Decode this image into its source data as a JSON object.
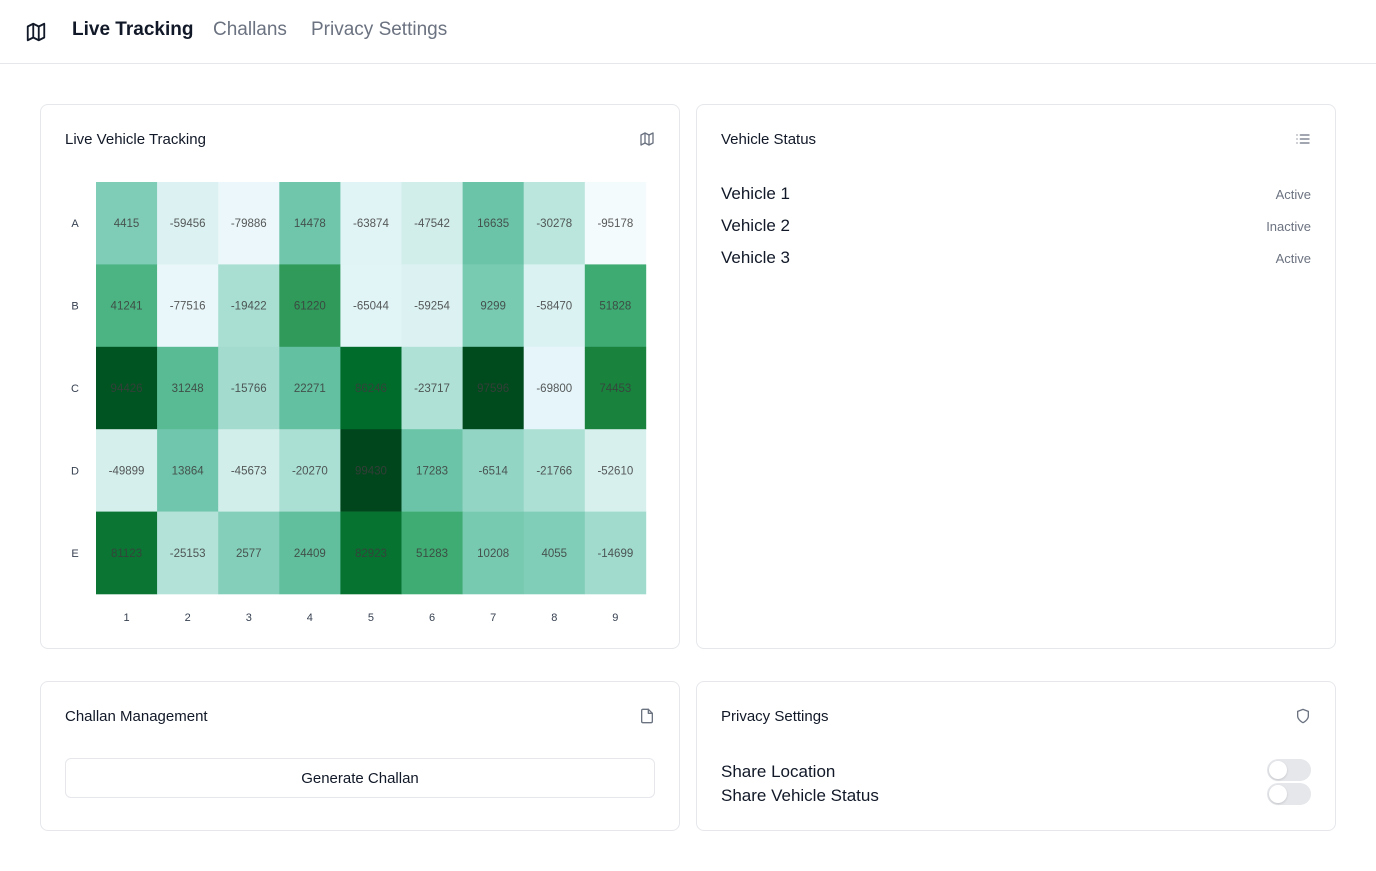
{
  "nav": {
    "brand_icon": "map-icon",
    "links": [
      {
        "label": "Live Tracking",
        "active": true
      },
      {
        "label": "Challans",
        "active": false
      },
      {
        "label": "Privacy Settings",
        "active": false
      }
    ]
  },
  "tracking": {
    "title": "Live Vehicle Tracking",
    "icon": "map-icon"
  },
  "status_panel": {
    "title": "Vehicle Status",
    "icon": "list-icon",
    "vehicles": [
      {
        "name": "Vehicle 1",
        "status": "Active"
      },
      {
        "name": "Vehicle 2",
        "status": "Inactive"
      },
      {
        "name": "Vehicle 3",
        "status": "Active"
      }
    ]
  },
  "challan": {
    "title": "Challan Management",
    "icon": "file-icon",
    "button_label": "Generate Challan"
  },
  "privacy": {
    "title": "Privacy Settings",
    "icon": "shield-icon",
    "settings": [
      {
        "label": "Share Location",
        "enabled": false
      },
      {
        "label": "Share Vehicle Status",
        "enabled": false
      }
    ]
  },
  "chart_data": {
    "type": "heatmap",
    "title": "",
    "xlabel": "",
    "ylabel": "",
    "x_categories": [
      "1",
      "2",
      "3",
      "4",
      "5",
      "6",
      "7",
      "8",
      "9"
    ],
    "y_categories": [
      "A",
      "B",
      "C",
      "D",
      "E"
    ],
    "values": [
      [
        4415,
        -59456,
        -79886,
        14478,
        -63874,
        -47542,
        16635,
        -30278,
        -95178
      ],
      [
        41241,
        -77516,
        -19422,
        61220,
        -65044,
        -59254,
        9299,
        -58470,
        51828
      ],
      [
        94426,
        31248,
        -15766,
        22271,
        86246,
        -23717,
        97596,
        -69800,
        74453
      ],
      [
        -49899,
        13864,
        -45673,
        -20270,
        99430,
        17283,
        -6514,
        -21766,
        -52610
      ],
      [
        81123,
        -25153,
        2577,
        24409,
        82923,
        51283,
        10208,
        4055,
        -14699
      ]
    ],
    "colorscale": "Greens",
    "value_range": [
      -100000,
      100000
    ]
  }
}
